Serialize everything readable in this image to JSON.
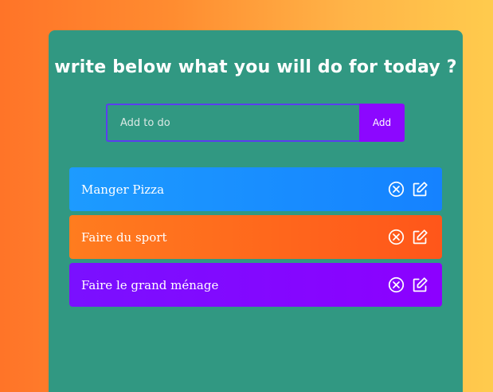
{
  "header": {
    "title": "write below what you will do for today ?"
  },
  "form": {
    "placeholder": "Add to do",
    "value": "",
    "add_label": "Add"
  },
  "todos": [
    {
      "text": "Manger Pizza",
      "color": "#1a8fff"
    },
    {
      "text": "Faire du sport",
      "color": "#ff6a1d"
    },
    {
      "text": "Faire le grand ménage",
      "color": "#8308ff"
    }
  ],
  "icons": {
    "delete": "close-circle-icon",
    "edit": "edit-icon"
  }
}
